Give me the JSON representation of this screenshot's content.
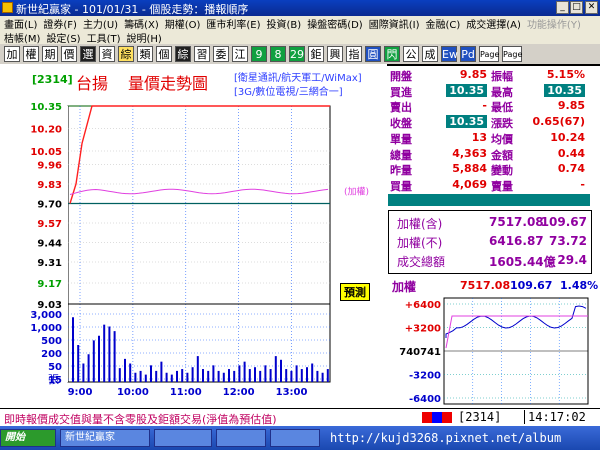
{
  "window": {
    "title": "新世紀贏家 - 101/01/31 - 個股走勢：播報順序"
  },
  "menu_row1": [
    "畫面(L)",
    "證券(F)",
    "主力(U)",
    "籌碼(X)",
    "期權(O)",
    "匯市利率(E)",
    "投資(B)",
    "操盤密碼(D)",
    "國際資訊(I)",
    "金融(C)",
    "成交選擇(A)",
    "功能操作(Y)"
  ],
  "menu_row2": [
    "桔帳(M)",
    "設定(S)",
    "工具(T)",
    "說明(H)"
  ],
  "toolbar": [
    "加",
    "權",
    "期",
    "價",
    "選",
    "資",
    "綜",
    "類",
    "個",
    "綜",
    "習",
    "委",
    "江",
    "9",
    "8",
    "29",
    "鉅",
    "興",
    "指",
    "圓",
    "閃",
    "公",
    "成",
    "Ew",
    "Pd",
    "Page Up",
    "Page Dn"
  ],
  "chart": {
    "code": "[2314]",
    "name": "台揚",
    "title": "量價走勢圖",
    "tag1": "[衛星通訊/航天軍工/WiMax]",
    "tag2": "[3G/數位電視/三網合一]",
    "y_labels": [
      "10.35",
      "10.20",
      "10.05",
      "9.96",
      "9.83",
      "9.70",
      "9.57",
      "9.44",
      "9.31",
      "9.17",
      "9.03"
    ],
    "index_label": "(加權)",
    "vol_labels": [
      "3,000",
      "1,000",
      "500",
      "200",
      "50",
      "15"
    ],
    "vol_unit": "張",
    "x_labels": [
      "9:00",
      "10:00",
      "11:00",
      "12:00",
      "13:00"
    ],
    "badge": "預測"
  },
  "chart_data": {
    "type": "line",
    "x": [
      "9:00",
      "10:00",
      "11:00",
      "12:00",
      "13:00"
    ],
    "ylim": [
      9.03,
      10.35
    ],
    "series": [
      {
        "name": "",
        "values": [
          9.7,
          10.35,
          10.35,
          10.35,
          10.35
        ]
      },
      {
        "name": "加權",
        "values": [
          9.76,
          9.79,
          9.8,
          9.78,
          9.8
        ]
      }
    ]
  },
  "quote": {
    "rows": [
      {
        "l": "開盤",
        "v": "9.85",
        "l2": "振幅",
        "v2": "5.15%"
      },
      {
        "l": "買進",
        "v": "10.35",
        "l2": "最高",
        "v2": "10.35"
      },
      {
        "l": "賣出",
        "v": "-",
        "l2": "最低",
        "v2": "9.85"
      },
      {
        "l": "收盤",
        "v": "10.35",
        "l2": "漲跌",
        "v2": "0.65(67)"
      },
      {
        "l": "單量",
        "v": "13",
        "l2": "均價",
        "v2": "10.24"
      },
      {
        "l": "總量",
        "v": "4,363",
        "l2": "金額",
        "v2": "0.44"
      },
      {
        "l": "昨量",
        "v": "5,884",
        "l2": "變動",
        "v2": "0.74"
      },
      {
        "l": "買量",
        "v": "4,069",
        "l2": "賣量",
        "v2": "-"
      }
    ],
    "index": [
      {
        "l": "加權(含)",
        "v": "7517.08",
        "v2": "109.67"
      },
      {
        "l": "加權(不)",
        "v": "6416.87",
        "v2": "73.72"
      },
      {
        "l": "成交總額",
        "v": "1605.44億",
        "v2": "29.4"
      }
    ]
  },
  "mini": {
    "label": "加權",
    "value": "7517.08",
    "change": "109.67",
    "pct": "1.48%",
    "y_labels": [
      "+6400",
      "+3200",
      "740741",
      "-3200",
      "-6400"
    ]
  },
  "status": {
    "note": "即時報價成交值與量不含零股及鉅額交易(淨值為預估值)",
    "code": "2314",
    "time": "14:17:02"
  },
  "taskbar": {
    "start": "開始",
    "tasks": [
      "新世紀贏家",
      "",
      "",
      ""
    ],
    "url": "http://kujd3268.pixnet.net/album"
  },
  "colors": {
    "price": "#ff2020",
    "index": "#e040e0",
    "volume": "#0000cc",
    "teal": "#008080"
  }
}
